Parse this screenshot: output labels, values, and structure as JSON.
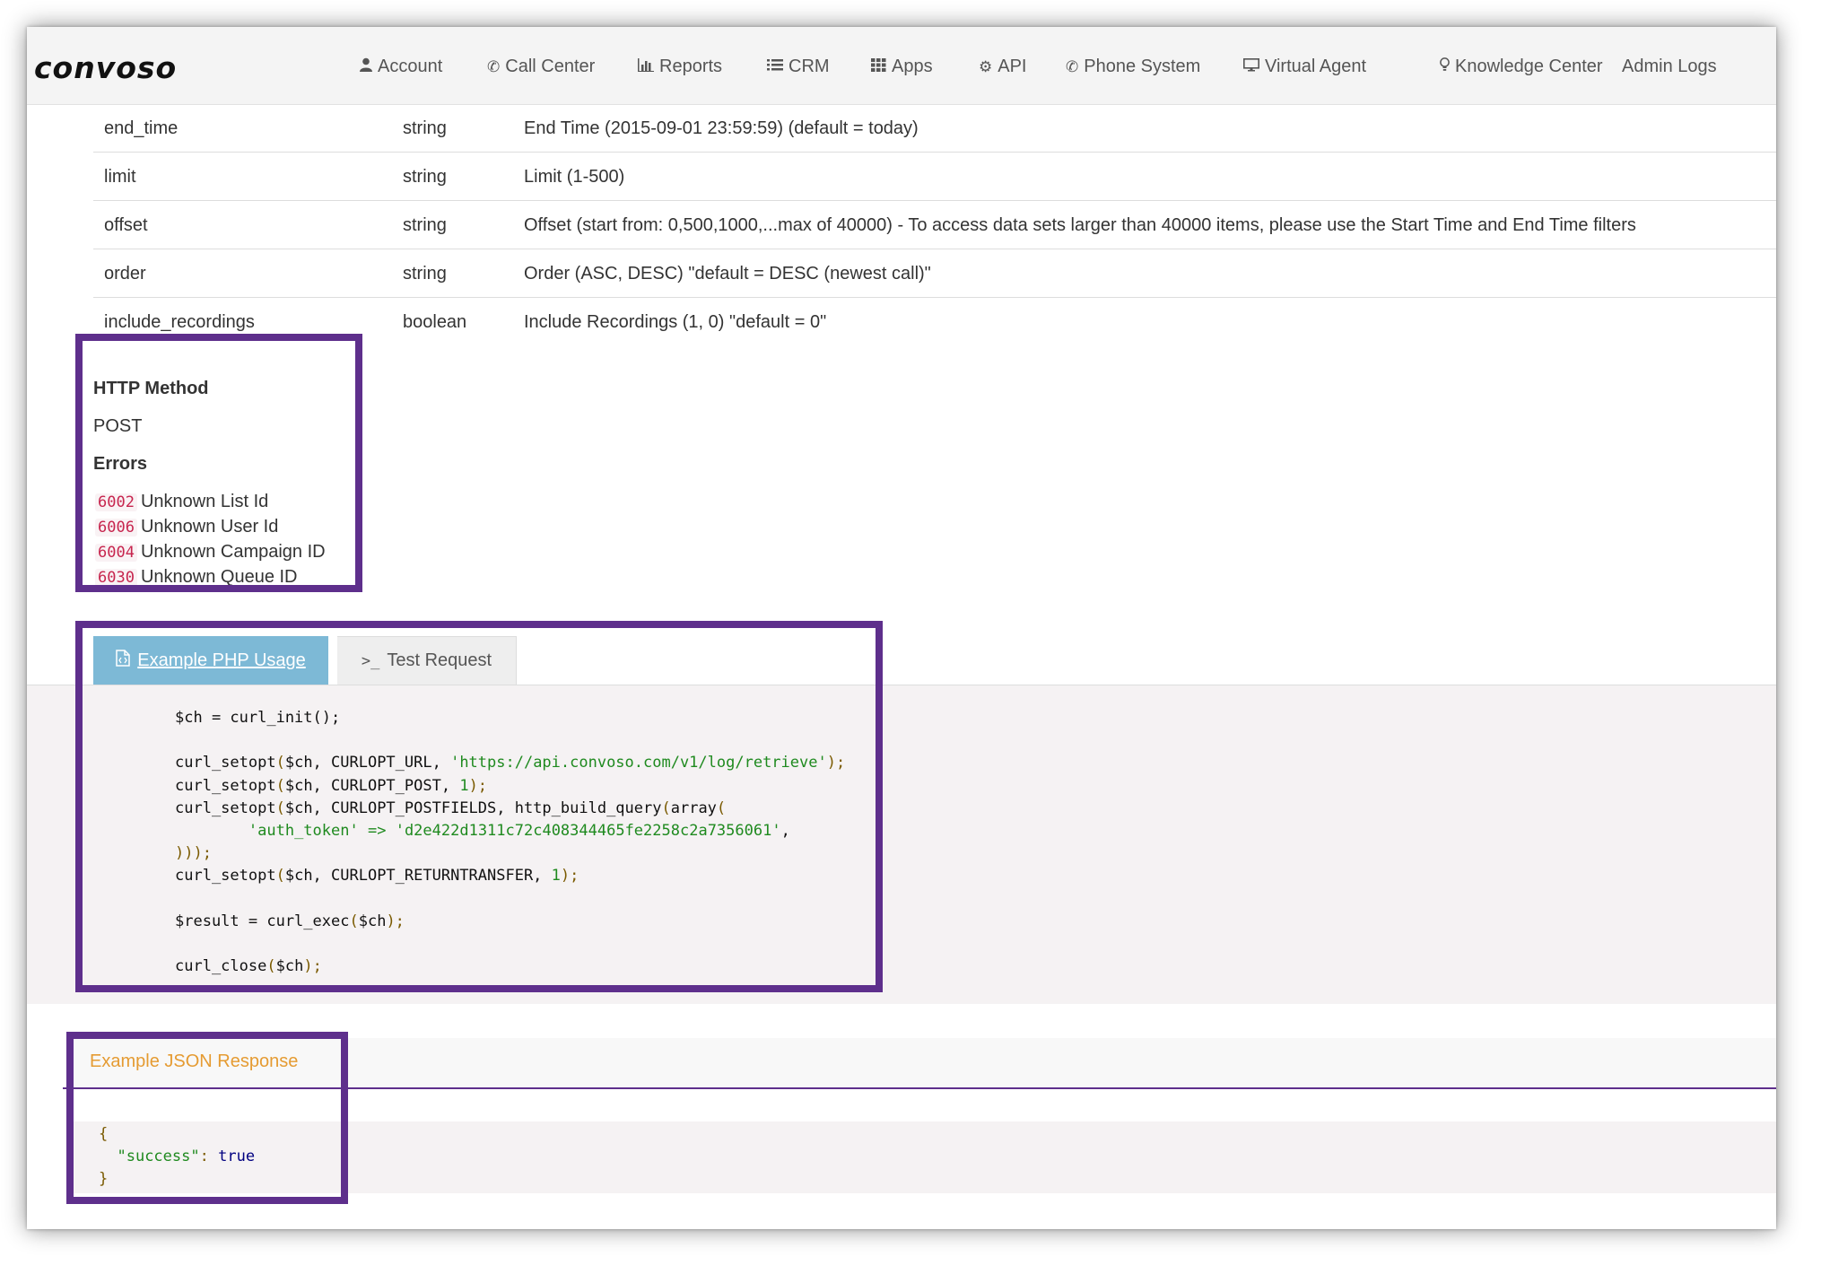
{
  "brand": {
    "logo_text": "convoso"
  },
  "nav": {
    "items": [
      {
        "label": "Account",
        "icon": "user-icon"
      },
      {
        "label": "Call Center",
        "icon": "phone-icon"
      },
      {
        "label": "Reports",
        "icon": "bar-chart-icon"
      },
      {
        "label": "CRM",
        "icon": "list-icon"
      },
      {
        "label": "Apps",
        "icon": "grid-icon"
      },
      {
        "label": "API",
        "icon": "gear-icon"
      },
      {
        "label": "Phone System",
        "icon": "phone-icon"
      },
      {
        "label": "Virtual Agent",
        "icon": "monitor-icon"
      },
      {
        "label": "Knowledge Center",
        "icon": "lightbulb-icon"
      },
      {
        "label": "Admin Logs",
        "icon": ""
      }
    ]
  },
  "params": [
    {
      "name": "end_time",
      "type": "string",
      "description": "End Time (2015-09-01 23:59:59) (default = today)"
    },
    {
      "name": "limit",
      "type": "string",
      "description": "Limit (1-500)"
    },
    {
      "name": "offset",
      "type": "string",
      "description": "Offset (start from: 0,500,1000,...max of 40000) - To access data sets larger than 40000 items, please use the Start Time and End Time filters"
    },
    {
      "name": "order",
      "type": "string",
      "description": "Order (ASC, DESC) \"default = DESC (newest call)\""
    },
    {
      "name": "include_recordings",
      "type": "boolean",
      "description": "Include Recordings (1, 0) \"default = 0\""
    }
  ],
  "http": {
    "method_heading": "HTTP Method",
    "method": "POST",
    "errors_heading": "Errors",
    "errors": [
      {
        "code": "6002",
        "message": "Unknown List Id"
      },
      {
        "code": "6006",
        "message": "Unknown User Id"
      },
      {
        "code": "6004",
        "message": "Unknown Campaign ID"
      },
      {
        "code": "6030",
        "message": "Unknown Queue ID"
      }
    ]
  },
  "tabs": {
    "php_label": "Example PHP Usage",
    "php_icon": "document-code-icon",
    "test_label": "Test Request",
    "test_icon": "terminal-icon"
  },
  "php_code": {
    "line1": "$ch = curl_init();",
    "url": "'https://api.convoso.com/v1/log/retrieve'",
    "auth_key": "'auth_token'",
    "auth_value": "'d2e422d1311c72c408344465fe2258c2a7356061'"
  },
  "json_response": {
    "heading": "Example JSON Response",
    "key": "\"success\"",
    "value": "true"
  },
  "colors": {
    "highlight_box": "#5e2f8c",
    "active_tab": "#7db9d6",
    "json_heading": "#e59b32",
    "error_code": "#c7254e",
    "code_string": "#1f8a1f"
  }
}
